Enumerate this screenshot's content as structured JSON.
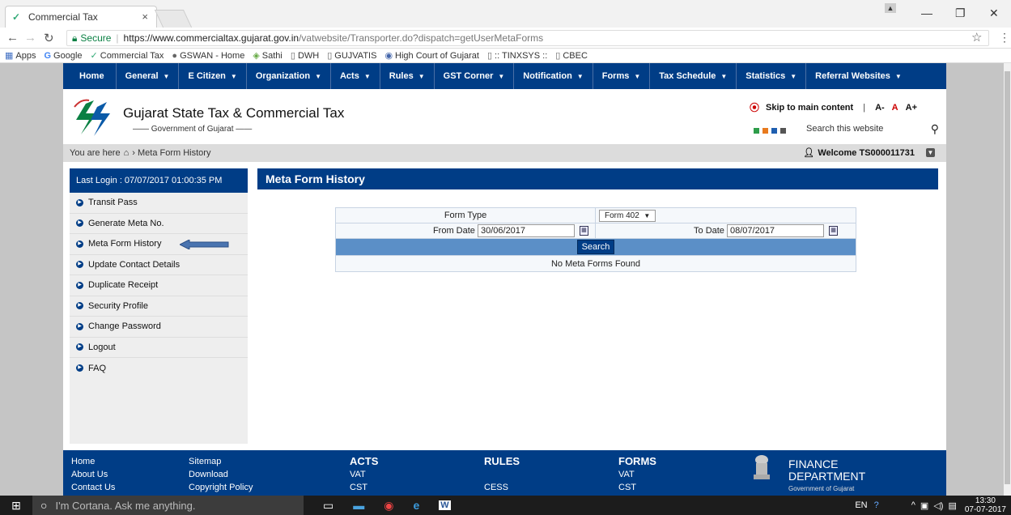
{
  "browser": {
    "tab_title": "Commercial Tax",
    "tab_close": "×",
    "secure_label": "Secure",
    "url_host": "https://www.commercialtax.gujarat.gov.in",
    "url_path": "/vatwebsite/Transporter.do?dispatch=getUserMetaForms",
    "bookmarks": [
      "Apps",
      "Google",
      "Commercial Tax",
      "GSWAN - Home",
      "Sathi",
      "DWH",
      "GUJVATIS",
      "High Court of Gujarat",
      ":: TINXSYS ::",
      "CBEC"
    ]
  },
  "nav": {
    "items": [
      "Home",
      "General",
      "E Citizen",
      "Organization",
      "Acts",
      "Rules",
      "GST Corner",
      "Notification",
      "Forms",
      "Tax Schedule",
      "Statistics",
      "Referral Websites"
    ]
  },
  "header": {
    "title": "Gujarat State Tax & Commercial Tax",
    "subtitle": "Government of Gujarat",
    "skip_label": "Skip to main content",
    "font_small": "A-",
    "font_normal": "A",
    "font_large": "A+",
    "search_placeholder": "Search this website",
    "color_squares": [
      "#2e9d4a",
      "#e87a1e",
      "#1f5fb0",
      "#555555"
    ]
  },
  "breadcrumb": {
    "prefix": "You are here",
    "current": "Meta Form History",
    "welcome": "Welcome TS000011731"
  },
  "sidebar": {
    "last_login": "Last Login : 07/07/2017 01:00:35 PM",
    "items": [
      "Transit Pass",
      "Generate Meta No.",
      "Meta Form History",
      "Update Contact Details",
      "Duplicate Receipt",
      "Security Profile",
      "Change Password",
      "Logout",
      "FAQ"
    ]
  },
  "content": {
    "heading": "Meta Form History",
    "form_type_label": "Form Type",
    "form_type_value": "Form 402",
    "from_date_label": "From Date",
    "from_date_value": "30/06/2017",
    "to_date_label": "To Date",
    "to_date_value": "08/07/2017",
    "search_button": "Search",
    "no_results": "No Meta Forms Found"
  },
  "footer": {
    "col1": [
      "Home",
      "About Us",
      "Contact Us"
    ],
    "col2": [
      "Sitemap",
      "Download",
      "Copyright Policy"
    ],
    "acts": {
      "heading": "ACTS",
      "items": [
        "VAT",
        "CST"
      ]
    },
    "rules": {
      "heading": "RULES",
      "items": [
        "CESS"
      ]
    },
    "forms": {
      "heading": "FORMS",
      "items": [
        "VAT",
        "CST"
      ]
    },
    "dept_line1": "FINANCE",
    "dept_line2": "DEPARTMENT",
    "dept_line3": "Government of Gujarat"
  },
  "taskbar": {
    "cortana": "I'm Cortana. Ask me anything.",
    "lang": "EN",
    "time": "13:30",
    "date": "07-07-2017"
  },
  "colors": {
    "brand_blue": "#003d86",
    "search_bar": "#5b8fc7"
  }
}
